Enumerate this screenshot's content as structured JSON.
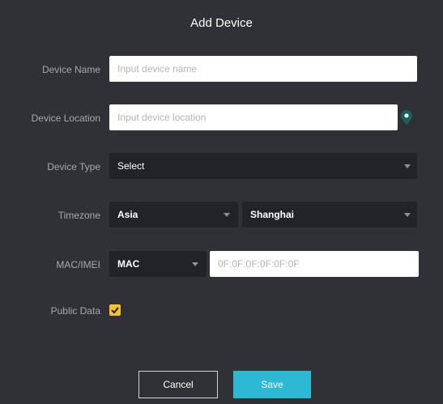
{
  "dialog": {
    "title": "Add Device",
    "device_name": {
      "label": "Device Name",
      "placeholder": "Input device name"
    },
    "device_location": {
      "label": "Device Location",
      "placeholder": "Input device location",
      "icon": "location-pin-icon"
    },
    "device_type": {
      "label": "Device Type",
      "value": "Select"
    },
    "timezone": {
      "label": "Timezone",
      "region": "Asia",
      "city": "Shanghai"
    },
    "mac_imei": {
      "label": "MAC/IMEI",
      "type": "MAC",
      "placeholder": "0F:0F:0F:0F:0F:0F"
    },
    "public_data": {
      "label": "Public Data",
      "checked": true
    },
    "buttons": {
      "cancel": "Cancel",
      "save": "Save"
    }
  },
  "colors": {
    "background": "#303136",
    "field_dark": "#222328",
    "accent": "#2db8d4",
    "checkbox": "#f5c12e",
    "pin": "#1d5f5a"
  }
}
